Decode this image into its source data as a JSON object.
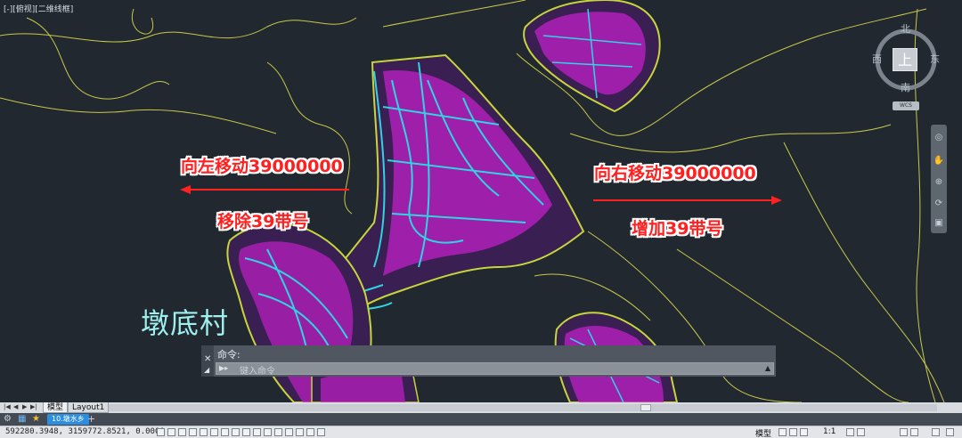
{
  "viewport": {
    "label": "[-][俯视][二维线框]",
    "annotations": {
      "move_left_title": "向左移动39000000",
      "move_left_sub": "移除39带号",
      "move_right_title": "向右移动39000000",
      "move_right_sub": "增加39带号"
    },
    "village_label": "墩底村",
    "colors": {
      "annotation": "#ff1f1f",
      "village_label": "#9ef0ee",
      "buildings": "#d62ad8",
      "roads": "#2fd4e0",
      "contours": "#c8d43a",
      "background": "#212830"
    }
  },
  "viewcube": {
    "north": "北",
    "south": "南",
    "east": "东",
    "west": "西",
    "face": "上",
    "wcs": "WCS"
  },
  "command_line": {
    "history": "命令:",
    "placeholder": "键入命令",
    "close_icon": "close-icon",
    "customize_icon": "wrench-icon"
  },
  "layout_tabs": {
    "model": "模型",
    "layout1": "Layout1"
  },
  "file_tabs": {
    "active": "10.墩水乡",
    "new_tab": "+"
  },
  "statusbar": {
    "coordinates": "592280.3948, 3159772.8521, 0.0000",
    "model_label": "模型",
    "annotation_scale": "1:1"
  }
}
